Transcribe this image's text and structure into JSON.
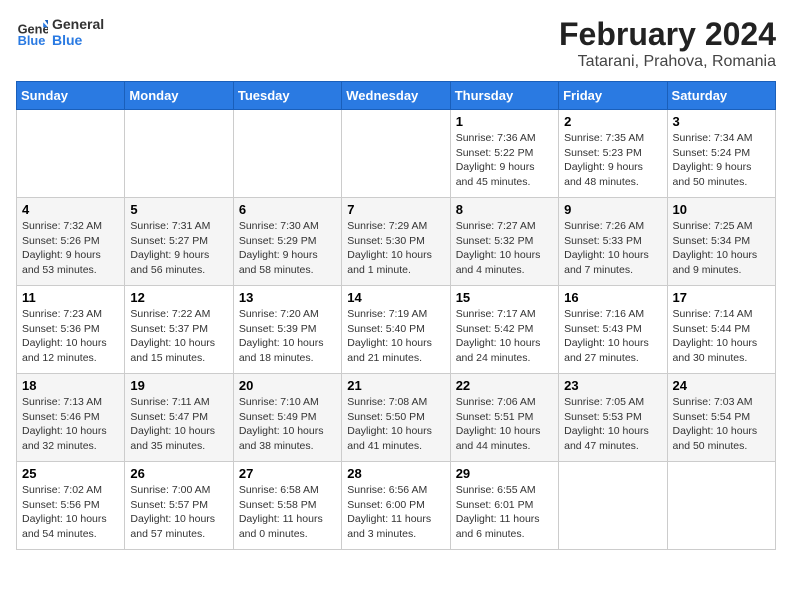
{
  "header": {
    "logo_line1": "General",
    "logo_line2": "Blue",
    "title": "February 2024",
    "subtitle": "Tatarani, Prahova, Romania"
  },
  "columns": [
    "Sunday",
    "Monday",
    "Tuesday",
    "Wednesday",
    "Thursday",
    "Friday",
    "Saturday"
  ],
  "weeks": [
    [
      {
        "day": "",
        "info": ""
      },
      {
        "day": "",
        "info": ""
      },
      {
        "day": "",
        "info": ""
      },
      {
        "day": "",
        "info": ""
      },
      {
        "day": "1",
        "info": "Sunrise: 7:36 AM\nSunset: 5:22 PM\nDaylight: 9 hours\nand 45 minutes."
      },
      {
        "day": "2",
        "info": "Sunrise: 7:35 AM\nSunset: 5:23 PM\nDaylight: 9 hours\nand 48 minutes."
      },
      {
        "day": "3",
        "info": "Sunrise: 7:34 AM\nSunset: 5:24 PM\nDaylight: 9 hours\nand 50 minutes."
      }
    ],
    [
      {
        "day": "4",
        "info": "Sunrise: 7:32 AM\nSunset: 5:26 PM\nDaylight: 9 hours\nand 53 minutes."
      },
      {
        "day": "5",
        "info": "Sunrise: 7:31 AM\nSunset: 5:27 PM\nDaylight: 9 hours\nand 56 minutes."
      },
      {
        "day": "6",
        "info": "Sunrise: 7:30 AM\nSunset: 5:29 PM\nDaylight: 9 hours\nand 58 minutes."
      },
      {
        "day": "7",
        "info": "Sunrise: 7:29 AM\nSunset: 5:30 PM\nDaylight: 10 hours\nand 1 minute."
      },
      {
        "day": "8",
        "info": "Sunrise: 7:27 AM\nSunset: 5:32 PM\nDaylight: 10 hours\nand 4 minutes."
      },
      {
        "day": "9",
        "info": "Sunrise: 7:26 AM\nSunset: 5:33 PM\nDaylight: 10 hours\nand 7 minutes."
      },
      {
        "day": "10",
        "info": "Sunrise: 7:25 AM\nSunset: 5:34 PM\nDaylight: 10 hours\nand 9 minutes."
      }
    ],
    [
      {
        "day": "11",
        "info": "Sunrise: 7:23 AM\nSunset: 5:36 PM\nDaylight: 10 hours\nand 12 minutes."
      },
      {
        "day": "12",
        "info": "Sunrise: 7:22 AM\nSunset: 5:37 PM\nDaylight: 10 hours\nand 15 minutes."
      },
      {
        "day": "13",
        "info": "Sunrise: 7:20 AM\nSunset: 5:39 PM\nDaylight: 10 hours\nand 18 minutes."
      },
      {
        "day": "14",
        "info": "Sunrise: 7:19 AM\nSunset: 5:40 PM\nDaylight: 10 hours\nand 21 minutes."
      },
      {
        "day": "15",
        "info": "Sunrise: 7:17 AM\nSunset: 5:42 PM\nDaylight: 10 hours\nand 24 minutes."
      },
      {
        "day": "16",
        "info": "Sunrise: 7:16 AM\nSunset: 5:43 PM\nDaylight: 10 hours\nand 27 minutes."
      },
      {
        "day": "17",
        "info": "Sunrise: 7:14 AM\nSunset: 5:44 PM\nDaylight: 10 hours\nand 30 minutes."
      }
    ],
    [
      {
        "day": "18",
        "info": "Sunrise: 7:13 AM\nSunset: 5:46 PM\nDaylight: 10 hours\nand 32 minutes."
      },
      {
        "day": "19",
        "info": "Sunrise: 7:11 AM\nSunset: 5:47 PM\nDaylight: 10 hours\nand 35 minutes."
      },
      {
        "day": "20",
        "info": "Sunrise: 7:10 AM\nSunset: 5:49 PM\nDaylight: 10 hours\nand 38 minutes."
      },
      {
        "day": "21",
        "info": "Sunrise: 7:08 AM\nSunset: 5:50 PM\nDaylight: 10 hours\nand 41 minutes."
      },
      {
        "day": "22",
        "info": "Sunrise: 7:06 AM\nSunset: 5:51 PM\nDaylight: 10 hours\nand 44 minutes."
      },
      {
        "day": "23",
        "info": "Sunrise: 7:05 AM\nSunset: 5:53 PM\nDaylight: 10 hours\nand 47 minutes."
      },
      {
        "day": "24",
        "info": "Sunrise: 7:03 AM\nSunset: 5:54 PM\nDaylight: 10 hours\nand 50 minutes."
      }
    ],
    [
      {
        "day": "25",
        "info": "Sunrise: 7:02 AM\nSunset: 5:56 PM\nDaylight: 10 hours\nand 54 minutes."
      },
      {
        "day": "26",
        "info": "Sunrise: 7:00 AM\nSunset: 5:57 PM\nDaylight: 10 hours\nand 57 minutes."
      },
      {
        "day": "27",
        "info": "Sunrise: 6:58 AM\nSunset: 5:58 PM\nDaylight: 11 hours\nand 0 minutes."
      },
      {
        "day": "28",
        "info": "Sunrise: 6:56 AM\nSunset: 6:00 PM\nDaylight: 11 hours\nand 3 minutes."
      },
      {
        "day": "29",
        "info": "Sunrise: 6:55 AM\nSunset: 6:01 PM\nDaylight: 11 hours\nand 6 minutes."
      },
      {
        "day": "",
        "info": ""
      },
      {
        "day": "",
        "info": ""
      }
    ]
  ]
}
